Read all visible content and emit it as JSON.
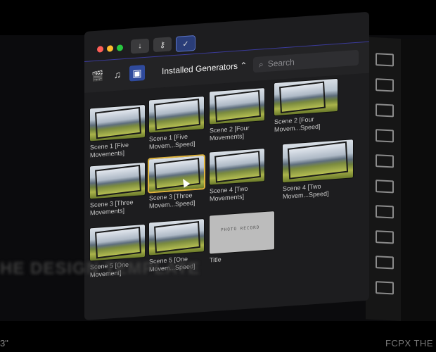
{
  "window": {
    "toolbar_buttons": [
      {
        "icon": "download-arrow-icon",
        "glyph": "↓"
      },
      {
        "icon": "key-icon",
        "glyph": "⚷"
      },
      {
        "icon": "checkmark-badge-icon",
        "glyph": "✓"
      }
    ]
  },
  "browser": {
    "title": "Installed Generators ⌃",
    "search_placeholder": "Search",
    "category_icons": [
      "clapper-icon",
      "music-notes-icon",
      "generators-icon"
    ]
  },
  "tiles": [
    {
      "label": "Scene 1 [Five Movements]",
      "selected": false
    },
    {
      "label": "Scene 1 [Five Movem...Speed]",
      "selected": false
    },
    {
      "label": "Scene 2 [Four Movements]",
      "selected": false
    },
    {
      "label": "Scene 2 [Four Movem...Speed]",
      "selected": false
    },
    {
      "label": "Scene 3 [Three Movements]",
      "selected": false
    },
    {
      "label": "Scene 3 [Three Movem...Speed]",
      "selected": true
    },
    {
      "label": "Scene 4 [Two Movements]",
      "selected": false
    },
    {
      "label": "Scene 4 [Two Movem...Speed]",
      "selected": false
    },
    {
      "label": "Scene 5 [One Movement]",
      "selected": false
    },
    {
      "label": "Scene 5 [One Movem...Speed]",
      "selected": false
    },
    {
      "label": "Title",
      "selected": false,
      "thumb_text": "PHOTO RECORD"
    }
  ],
  "overlay": {
    "bottom_left": "3\"",
    "bottom_right": "FCPX THE"
  },
  "colors": {
    "accent": "#2f4a9c",
    "selection": "#e0b43c",
    "panel": "#1d1d1f"
  }
}
